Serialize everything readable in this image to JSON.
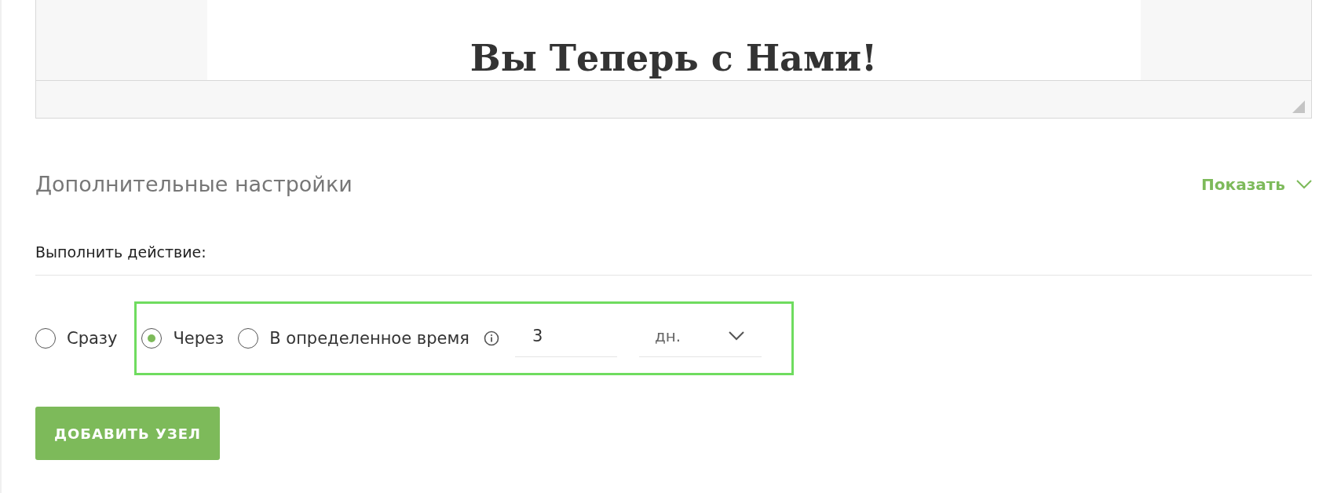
{
  "editor": {
    "heading": "Вы Теперь с Нами!"
  },
  "advanced": {
    "title": "Дополнительные настройки",
    "toggle": "Показать",
    "expanded": false
  },
  "action": {
    "label": "Выполнить действие:",
    "options": [
      {
        "label": "Сразу",
        "selected": false
      },
      {
        "label": "Через",
        "selected": true
      },
      {
        "label": "В определенное время",
        "selected": false
      }
    ],
    "amount": "3",
    "unit": "дн."
  },
  "submit": "ДОБАВИТЬ УЗЕЛ"
}
